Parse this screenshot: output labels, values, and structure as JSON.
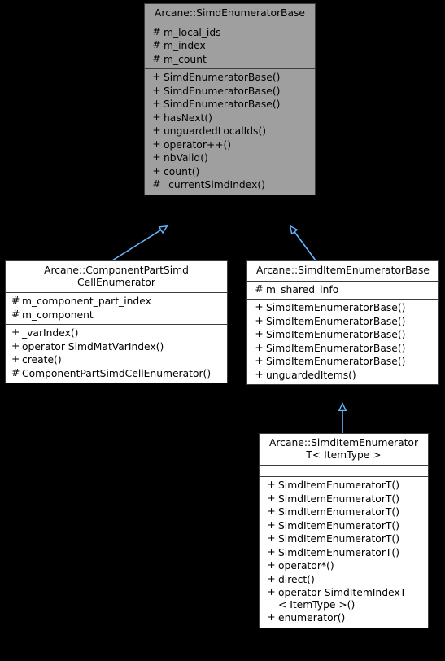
{
  "diagram": {
    "title": "UML class inheritance diagram",
    "background_color": "#000000",
    "box_fill_color": "#ffffff",
    "box_highlight_fill_color": "#9f9f9f",
    "border_color": "#3c3c3c",
    "edge_color": "#63b8ff",
    "relation": "inheritance"
  },
  "classes": {
    "simd_enumerator_base": {
      "name": "Arcane::SimdEnumeratorBase",
      "attributes": [
        {
          "visibility": "#",
          "member": "m_local_ids"
        },
        {
          "visibility": "#",
          "member": "m_index"
        },
        {
          "visibility": "#",
          "member": "m_count"
        }
      ],
      "operations": [
        {
          "visibility": "+",
          "member": "SimdEnumeratorBase()"
        },
        {
          "visibility": "+",
          "member": "SimdEnumeratorBase()"
        },
        {
          "visibility": "+",
          "member": "SimdEnumeratorBase()"
        },
        {
          "visibility": "+",
          "member": "hasNext()"
        },
        {
          "visibility": "+",
          "member": "unguardedLocalIds()"
        },
        {
          "visibility": "+",
          "member": "operator++()"
        },
        {
          "visibility": "+",
          "member": "nbValid()"
        },
        {
          "visibility": "+",
          "member": "count()"
        },
        {
          "visibility": "#",
          "member": "_currentSimdIndex()"
        }
      ]
    },
    "component_part_simd_cell_enumerator": {
      "name": "Arcane::ComponentPartSimd\nCellEnumerator",
      "attributes": [
        {
          "visibility": "#",
          "member": "m_component_part_index"
        },
        {
          "visibility": "#",
          "member": "m_component"
        }
      ],
      "operations": [
        {
          "visibility": "+",
          "member": "_varIndex()"
        },
        {
          "visibility": "+",
          "member": "operator SimdMatVarIndex()"
        },
        {
          "visibility": "+",
          "member": "create()"
        },
        {
          "visibility": "#",
          "member": "ComponentPartSimdCellEnumerator()"
        }
      ]
    },
    "simd_item_enumerator_base": {
      "name": "Arcane::SimdItemEnumeratorBase",
      "attributes": [
        {
          "visibility": "#",
          "member": "m_shared_info"
        }
      ],
      "operations": [
        {
          "visibility": "+",
          "member": "SimdItemEnumeratorBase()"
        },
        {
          "visibility": "+",
          "member": "SimdItemEnumeratorBase()"
        },
        {
          "visibility": "+",
          "member": "SimdItemEnumeratorBase()"
        },
        {
          "visibility": "+",
          "member": "SimdItemEnumeratorBase()"
        },
        {
          "visibility": "+",
          "member": "SimdItemEnumeratorBase()"
        },
        {
          "visibility": "+",
          "member": "unguardedItems()"
        }
      ]
    },
    "simd_item_enumerator_t": {
      "name": "Arcane::SimdItemEnumerator\nT< ItemType >",
      "attributes": [],
      "operations": [
        {
          "visibility": "+",
          "member": "SimdItemEnumeratorT()"
        },
        {
          "visibility": "+",
          "member": "SimdItemEnumeratorT()"
        },
        {
          "visibility": "+",
          "member": "SimdItemEnumeratorT()"
        },
        {
          "visibility": "+",
          "member": "SimdItemEnumeratorT()"
        },
        {
          "visibility": "+",
          "member": "SimdItemEnumeratorT()"
        },
        {
          "visibility": "+",
          "member": "SimdItemEnumeratorT()"
        },
        {
          "visibility": "+",
          "member": "operator*()"
        },
        {
          "visibility": "+",
          "member": "direct()"
        },
        {
          "visibility": "+",
          "member": "operator SimdItemIndexT\n< ItemType >()"
        },
        {
          "visibility": "+",
          "member": "enumerator()"
        }
      ]
    }
  }
}
